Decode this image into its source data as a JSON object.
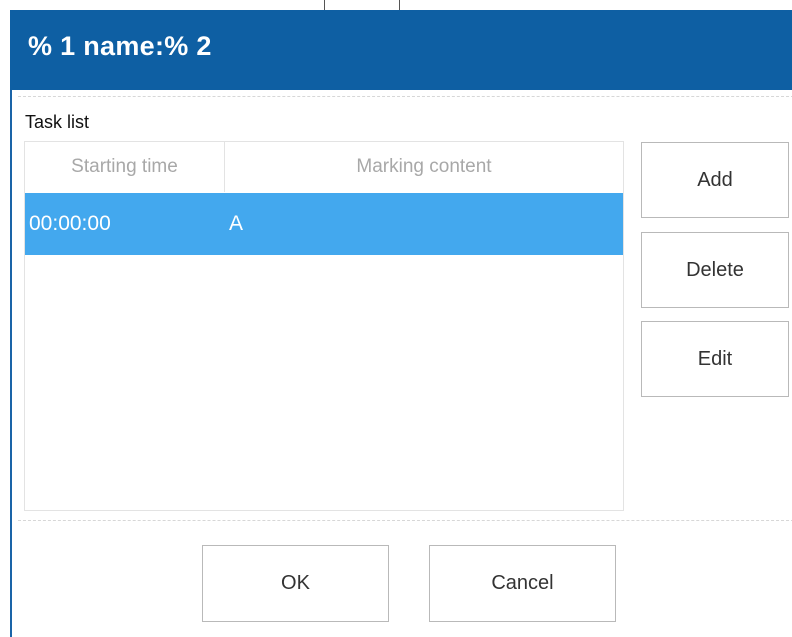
{
  "window": {
    "title": "% 1 name:% 2"
  },
  "task_list": {
    "label": "Task list",
    "columns": [
      "Starting time",
      "Marking content"
    ],
    "rows": [
      {
        "start_time": "00:00:00",
        "content": "A",
        "selected": true
      }
    ]
  },
  "side_buttons": {
    "add": "Add",
    "delete": "Delete",
    "edit": "Edit"
  },
  "footer_buttons": {
    "ok": "OK",
    "cancel": "Cancel"
  },
  "colors": {
    "title_bar": "#0e5fa3",
    "selected_row": "#43a8ee",
    "header_text": "#a8a8a8",
    "button_border": "#b9b9b9"
  }
}
